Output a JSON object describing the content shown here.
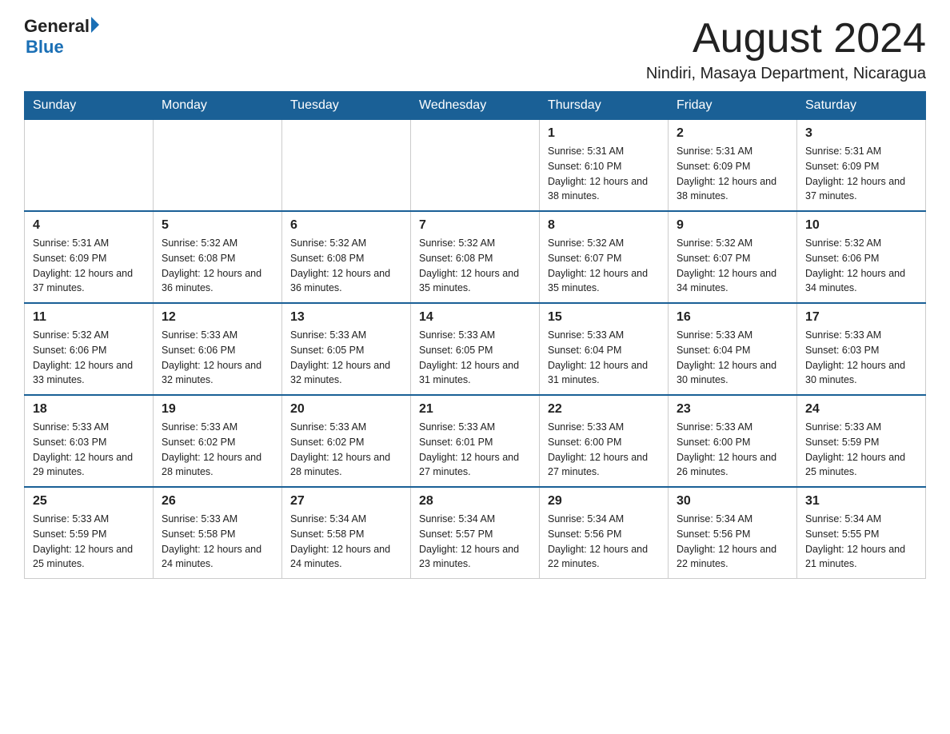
{
  "header": {
    "logo_general": "General",
    "logo_blue": "Blue",
    "month_title": "August 2024",
    "location": "Nindiri, Masaya Department, Nicaragua"
  },
  "weekdays": [
    "Sunday",
    "Monday",
    "Tuesday",
    "Wednesday",
    "Thursday",
    "Friday",
    "Saturday"
  ],
  "weeks": [
    [
      {
        "day": "",
        "info": ""
      },
      {
        "day": "",
        "info": ""
      },
      {
        "day": "",
        "info": ""
      },
      {
        "day": "",
        "info": ""
      },
      {
        "day": "1",
        "info": "Sunrise: 5:31 AM\nSunset: 6:10 PM\nDaylight: 12 hours and 38 minutes."
      },
      {
        "day": "2",
        "info": "Sunrise: 5:31 AM\nSunset: 6:09 PM\nDaylight: 12 hours and 38 minutes."
      },
      {
        "day": "3",
        "info": "Sunrise: 5:31 AM\nSunset: 6:09 PM\nDaylight: 12 hours and 37 minutes."
      }
    ],
    [
      {
        "day": "4",
        "info": "Sunrise: 5:31 AM\nSunset: 6:09 PM\nDaylight: 12 hours and 37 minutes."
      },
      {
        "day": "5",
        "info": "Sunrise: 5:32 AM\nSunset: 6:08 PM\nDaylight: 12 hours and 36 minutes."
      },
      {
        "day": "6",
        "info": "Sunrise: 5:32 AM\nSunset: 6:08 PM\nDaylight: 12 hours and 36 minutes."
      },
      {
        "day": "7",
        "info": "Sunrise: 5:32 AM\nSunset: 6:08 PM\nDaylight: 12 hours and 35 minutes."
      },
      {
        "day": "8",
        "info": "Sunrise: 5:32 AM\nSunset: 6:07 PM\nDaylight: 12 hours and 35 minutes."
      },
      {
        "day": "9",
        "info": "Sunrise: 5:32 AM\nSunset: 6:07 PM\nDaylight: 12 hours and 34 minutes."
      },
      {
        "day": "10",
        "info": "Sunrise: 5:32 AM\nSunset: 6:06 PM\nDaylight: 12 hours and 34 minutes."
      }
    ],
    [
      {
        "day": "11",
        "info": "Sunrise: 5:32 AM\nSunset: 6:06 PM\nDaylight: 12 hours and 33 minutes."
      },
      {
        "day": "12",
        "info": "Sunrise: 5:33 AM\nSunset: 6:06 PM\nDaylight: 12 hours and 32 minutes."
      },
      {
        "day": "13",
        "info": "Sunrise: 5:33 AM\nSunset: 6:05 PM\nDaylight: 12 hours and 32 minutes."
      },
      {
        "day": "14",
        "info": "Sunrise: 5:33 AM\nSunset: 6:05 PM\nDaylight: 12 hours and 31 minutes."
      },
      {
        "day": "15",
        "info": "Sunrise: 5:33 AM\nSunset: 6:04 PM\nDaylight: 12 hours and 31 minutes."
      },
      {
        "day": "16",
        "info": "Sunrise: 5:33 AM\nSunset: 6:04 PM\nDaylight: 12 hours and 30 minutes."
      },
      {
        "day": "17",
        "info": "Sunrise: 5:33 AM\nSunset: 6:03 PM\nDaylight: 12 hours and 30 minutes."
      }
    ],
    [
      {
        "day": "18",
        "info": "Sunrise: 5:33 AM\nSunset: 6:03 PM\nDaylight: 12 hours and 29 minutes."
      },
      {
        "day": "19",
        "info": "Sunrise: 5:33 AM\nSunset: 6:02 PM\nDaylight: 12 hours and 28 minutes."
      },
      {
        "day": "20",
        "info": "Sunrise: 5:33 AM\nSunset: 6:02 PM\nDaylight: 12 hours and 28 minutes."
      },
      {
        "day": "21",
        "info": "Sunrise: 5:33 AM\nSunset: 6:01 PM\nDaylight: 12 hours and 27 minutes."
      },
      {
        "day": "22",
        "info": "Sunrise: 5:33 AM\nSunset: 6:00 PM\nDaylight: 12 hours and 27 minutes."
      },
      {
        "day": "23",
        "info": "Sunrise: 5:33 AM\nSunset: 6:00 PM\nDaylight: 12 hours and 26 minutes."
      },
      {
        "day": "24",
        "info": "Sunrise: 5:33 AM\nSunset: 5:59 PM\nDaylight: 12 hours and 25 minutes."
      }
    ],
    [
      {
        "day": "25",
        "info": "Sunrise: 5:33 AM\nSunset: 5:59 PM\nDaylight: 12 hours and 25 minutes."
      },
      {
        "day": "26",
        "info": "Sunrise: 5:33 AM\nSunset: 5:58 PM\nDaylight: 12 hours and 24 minutes."
      },
      {
        "day": "27",
        "info": "Sunrise: 5:34 AM\nSunset: 5:58 PM\nDaylight: 12 hours and 24 minutes."
      },
      {
        "day": "28",
        "info": "Sunrise: 5:34 AM\nSunset: 5:57 PM\nDaylight: 12 hours and 23 minutes."
      },
      {
        "day": "29",
        "info": "Sunrise: 5:34 AM\nSunset: 5:56 PM\nDaylight: 12 hours and 22 minutes."
      },
      {
        "day": "30",
        "info": "Sunrise: 5:34 AM\nSunset: 5:56 PM\nDaylight: 12 hours and 22 minutes."
      },
      {
        "day": "31",
        "info": "Sunrise: 5:34 AM\nSunset: 5:55 PM\nDaylight: 12 hours and 21 minutes."
      }
    ]
  ]
}
